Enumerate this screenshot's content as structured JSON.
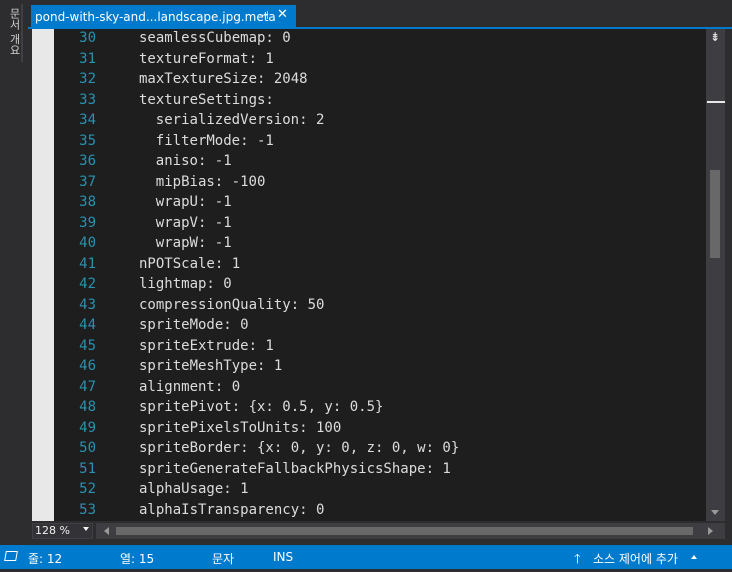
{
  "side_panel": {
    "label": "문서 개요"
  },
  "tab": {
    "title": "pond-with-sky-and...landscape.jpg.meta",
    "pin_glyph": "⊣",
    "close_glyph": "✕"
  },
  "editor": {
    "lines": [
      {
        "number": "30",
        "text": "    seamlessCubemap: 0"
      },
      {
        "number": "31",
        "text": "    textureFormat: 1"
      },
      {
        "number": "32",
        "text": "    maxTextureSize: 2048"
      },
      {
        "number": "33",
        "text": "    textureSettings:"
      },
      {
        "number": "34",
        "text": "      serializedVersion: 2"
      },
      {
        "number": "35",
        "text": "      filterMode: -1"
      },
      {
        "number": "36",
        "text": "      aniso: -1"
      },
      {
        "number": "37",
        "text": "      mipBias: -100"
      },
      {
        "number": "38",
        "text": "      wrapU: -1"
      },
      {
        "number": "39",
        "text": "      wrapV: -1"
      },
      {
        "number": "40",
        "text": "      wrapW: -1"
      },
      {
        "number": "41",
        "text": "    nPOTScale: 1"
      },
      {
        "number": "42",
        "text": "    lightmap: 0"
      },
      {
        "number": "43",
        "text": "    compressionQuality: 50"
      },
      {
        "number": "44",
        "text": "    spriteMode: 0"
      },
      {
        "number": "45",
        "text": "    spriteExtrude: 1"
      },
      {
        "number": "46",
        "text": "    spriteMeshType: 1"
      },
      {
        "number": "47",
        "text": "    alignment: 0"
      },
      {
        "number": "48",
        "text": "    spritePivot: {x: 0.5, y: 0.5}"
      },
      {
        "number": "49",
        "text": "    spritePixelsToUnits: 100"
      },
      {
        "number": "50",
        "text": "    spriteBorder: {x: 0, y: 0, z: 0, w: 0}"
      },
      {
        "number": "51",
        "text": "    spriteGenerateFallbackPhysicsShape: 1"
      },
      {
        "number": "52",
        "text": "    alphaUsage: 1"
      },
      {
        "number": "53",
        "text": "    alphaIsTransparency: 0"
      }
    ]
  },
  "zoom": {
    "value": "128 %"
  },
  "status": {
    "line": "줄: 12",
    "column": "열: 15",
    "char": "문자",
    "mode": "INS",
    "source_control": "소스 제어에 추가"
  },
  "colors": {
    "accent": "#007acc",
    "editor_bg": "#1e1e1e",
    "line_number": "#2b91af",
    "text": "#dcdcdc"
  }
}
